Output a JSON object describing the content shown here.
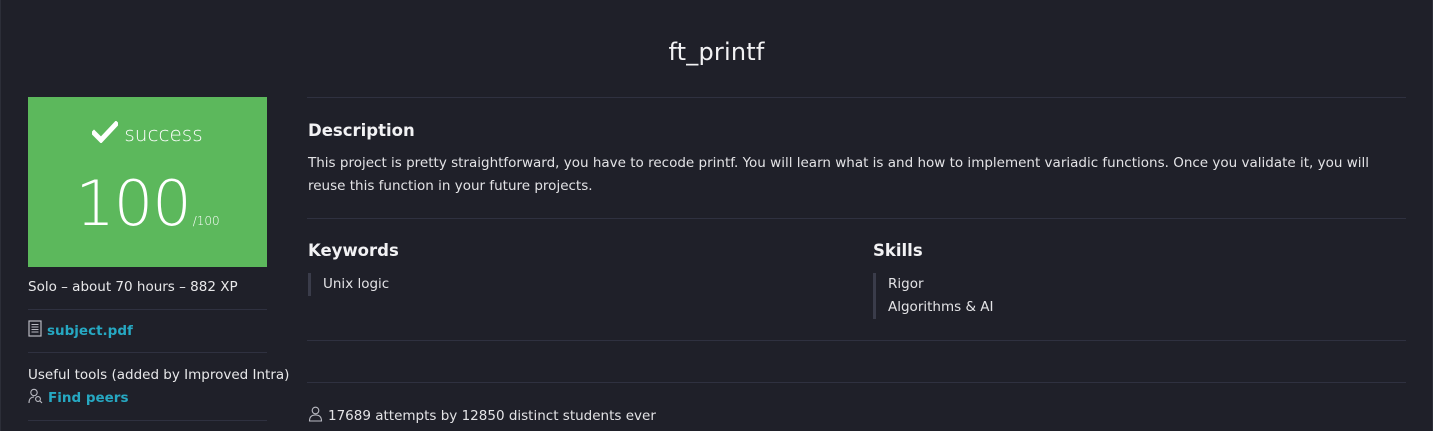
{
  "project": {
    "title": "ft_printf"
  },
  "score_card": {
    "status": "success",
    "status_icon": "check-icon",
    "score": "100",
    "max": "/100",
    "color": "#5cb85c"
  },
  "meta": {
    "summary": "Solo – about 70 hours – 882 XP"
  },
  "attachments": {
    "subject_label": "subject.pdf",
    "subject_icon": "document-icon"
  },
  "tools": {
    "label": "Useful tools (added by Improved Intra)",
    "find_peers_label": "Find peers",
    "find_peers_icon": "user-search-icon"
  },
  "description": {
    "heading": "Description",
    "text": "This project is pretty straightforward, you have to recode printf. You will learn what is and how to implement variadic functions. Once you validate it, you will reuse this function in your future projects."
  },
  "keywords": {
    "heading": "Keywords",
    "items": [
      "Unix logic"
    ]
  },
  "skills": {
    "heading": "Skills",
    "items": [
      "Rigor",
      "Algorithms & AI"
    ]
  },
  "stats": {
    "text": "17689 attempts by 12850 distinct students ever",
    "icon": "user-icon"
  },
  "colors": {
    "background": "#1f2029",
    "link": "#26a8c2"
  }
}
